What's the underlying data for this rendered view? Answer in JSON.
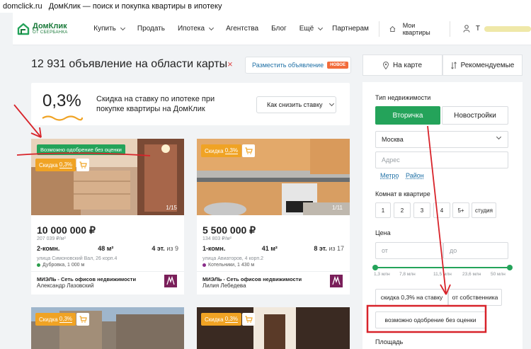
{
  "window": {
    "domain": "domclick.ru",
    "title": "ДомКлик — поиск и покупка квартиры в ипотеку"
  },
  "nav": {
    "logo_main": "ДомКлик",
    "logo_sub": "ОТ СБЕРБАНКА",
    "items": [
      {
        "label": "Купить",
        "dropdown": true
      },
      {
        "label": "Продать",
        "dropdown": false
      },
      {
        "label": "Ипотека",
        "dropdown": true
      },
      {
        "label": "Агентства",
        "dropdown": false
      },
      {
        "label": "Блог",
        "dropdown": false
      },
      {
        "label": "Ещё",
        "dropdown": true
      },
      {
        "label": "Партнерам",
        "dropdown": false
      }
    ],
    "my_apartments": "Мои квартиры",
    "user_initial": "Т"
  },
  "results": {
    "count_text": "12 931 объявление на области карты",
    "clear_icon": "×",
    "place_ad": "Разместить объявление",
    "new_badge": "НОВОЕ"
  },
  "view_tabs": {
    "map": "На карте",
    "sort": "Рекомендуемые"
  },
  "promo": {
    "percent": "0,3%",
    "text": "Скидка на ставку по ипотеке при покупке квартиры на ДомКлик",
    "how_button": "Как снизить ставку"
  },
  "cards": [
    {
      "approval": "Возможно одобрение без оценки",
      "discount_label": "Скидка",
      "discount_value": "0,3%",
      "photo_count": "1/15",
      "price": "10 000 000 ₽",
      "price_per_m": "207 039 ₽/м²",
      "rooms": "2-комн.",
      "area": "48 м²",
      "floor": "4 эт.",
      "floor_of": "из 9",
      "address": "улица Симоновский Вал, 26 корп.4",
      "metro": "Дубровка, 1 000 м",
      "agency": "МИЭЛЬ - Сеть офисов недвижимости",
      "agent": "Александр Лазовский"
    },
    {
      "discount_label": "Скидка",
      "discount_value": "0,3%",
      "photo_count": "1/11",
      "price": "5 500 000 ₽",
      "price_per_m": "134 803 ₽/м²",
      "rooms": "1-комн.",
      "area": "41 м²",
      "floor": "8 эт.",
      "floor_of": "из 17",
      "address": "улица Авиаторов, 4 корп.2",
      "metro": "Котельники, 1 430 м",
      "agency": "МИЭЛЬ - Сеть офисов недвижимости",
      "agent": "Лилия Лебедева"
    },
    {
      "discount_label": "Скидка",
      "discount_value": "0,3%"
    },
    {
      "discount_label": "Скидка",
      "discount_value": "0,3%"
    }
  ],
  "filters": {
    "property_type_label": "Тип недвижимости",
    "secondary": "Вторичка",
    "new_buildings": "Новостройки",
    "city": "Москва",
    "address_placeholder": "Адрес",
    "metro_link": "Метро",
    "district_link": "Район",
    "rooms_label": "Комнат в квартире",
    "rooms": [
      "1",
      "2",
      "3",
      "4",
      "5+",
      "студия"
    ],
    "price_label": "Цена",
    "price_from": "от",
    "price_to": "до",
    "price_ticks": [
      "1,3 млн",
      "7,8 млн",
      "11,5 млн",
      "23,6 млн",
      "50 млн"
    ],
    "tag_discount": "скидка 0,3% на ставку",
    "tag_owner": "от собственника",
    "tag_approval": "возможно одобрение без оценки",
    "area_label": "Площадь"
  },
  "colors": {
    "brand_green": "#24a35a",
    "discount_orange": "#f0a324",
    "annotation_red": "#d8232a",
    "link_blue": "#1d6fa5"
  }
}
